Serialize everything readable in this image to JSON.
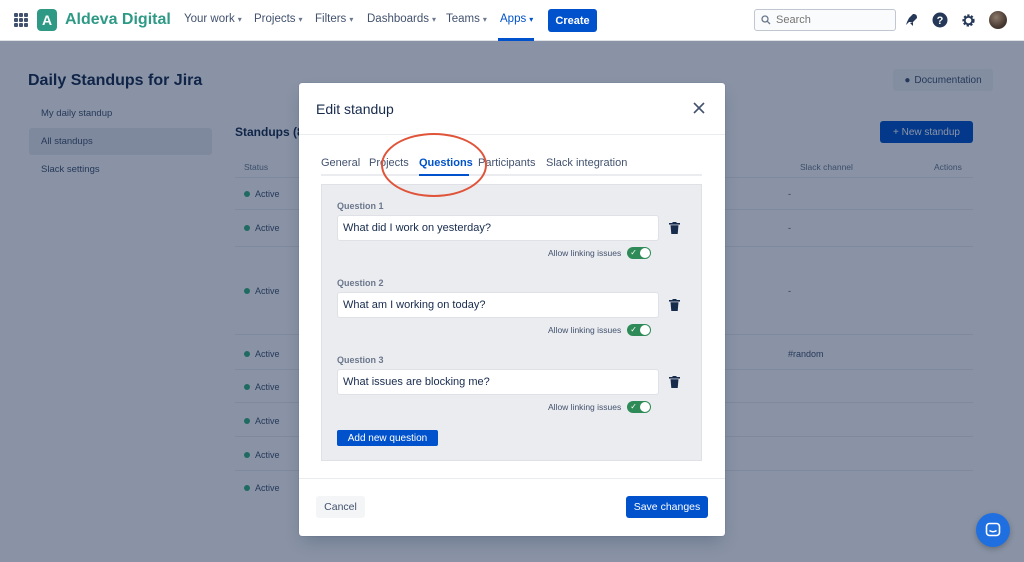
{
  "topnav": {
    "brand": "Aldeva Digital",
    "brand_initial": "A",
    "items": [
      {
        "label": "Your work"
      },
      {
        "label": "Projects"
      },
      {
        "label": "Filters"
      },
      {
        "label": "Dashboards"
      },
      {
        "label": "Teams"
      },
      {
        "label": "Apps"
      }
    ],
    "active_item": "Apps",
    "create_label": "Create",
    "search_placeholder": "Search",
    "icons": [
      "app-switcher-icon",
      "search-icon",
      "notifications-icon",
      "help-icon",
      "settings-icon",
      "avatar"
    ]
  },
  "background_page": {
    "title": "Daily Standups for Jira",
    "documentation_label": "Documentation",
    "sidebar": [
      {
        "label": "My daily standup"
      },
      {
        "label": "All standups"
      },
      {
        "label": "Slack settings"
      }
    ],
    "selected_sidebar_item": "All standups",
    "section_heading": "Standups (8)",
    "new_standup_label": "+ New standup",
    "columns": [
      "Status",
      "Slack channel",
      "Actions"
    ],
    "rows": [
      {
        "status": "Active",
        "slack": "-"
      },
      {
        "status": "Active",
        "slack": "-"
      },
      {
        "status": "Active",
        "slack": "-"
      },
      {
        "status": "Active",
        "slack": "#random"
      },
      {
        "status": "Active",
        "slack": ""
      },
      {
        "status": "Active",
        "slack": ""
      },
      {
        "status": "Active",
        "slack": ""
      },
      {
        "status": "Active",
        "slack": ""
      }
    ]
  },
  "modal": {
    "title": "Edit standup",
    "tabs": [
      {
        "label": "General"
      },
      {
        "label": "Projects"
      },
      {
        "label": "Questions"
      },
      {
        "label": "Participants"
      },
      {
        "label": "Slack integration"
      }
    ],
    "active_tab": "Questions",
    "questions": [
      {
        "label": "Question 1",
        "value": "What did I work on yesterday?",
        "allow_label": "Allow linking issues",
        "allow_linking": true
      },
      {
        "label": "Question 2",
        "value": "What am I working on today?",
        "allow_label": "Allow linking issues",
        "allow_linking": true
      },
      {
        "label": "Question 3",
        "value": "What issues are blocking me?",
        "allow_label": "Allow linking issues",
        "allow_linking": true
      }
    ],
    "add_question_label": "Add new question",
    "cancel_label": "Cancel",
    "save_label": "Save changes"
  },
  "colors": {
    "brand": "#2e9a86",
    "primary": "#0052cc",
    "toggle_on": "#2e8b57",
    "annotation": "#e0543a",
    "chat": "#1f6fe0"
  }
}
